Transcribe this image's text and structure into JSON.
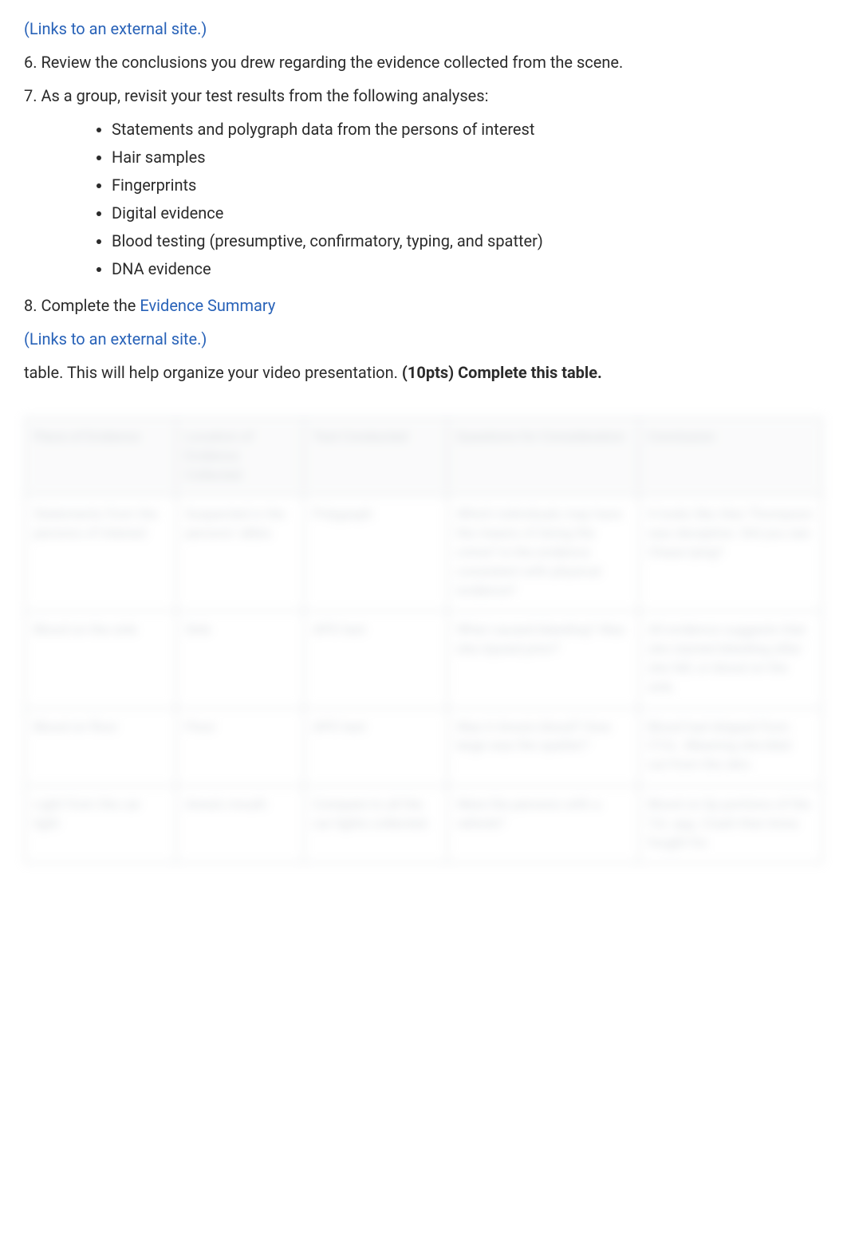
{
  "links": {
    "external1": " (Links to an external site.)",
    "evidenceSummary": "Evidence Summary",
    "external2": " (Links to an external site.)"
  },
  "paras": {
    "p6": "6. Review the conclusions you drew regarding the evidence collected from the scene.",
    "p7": "7. As a group, revisit your test results from the following analyses:",
    "p8_prefix": "8. Complete the ",
    "p9_prefix": " table. This will help organize your video presentation. ",
    "p9_bold": "(10pts) Complete this table."
  },
  "list": {
    "i1": "Statements and polygraph data from the persons of interest",
    "i2": "Hair samples",
    "i3": "Fingerprints",
    "i4": "Digital evidence",
    "i5": "Blood testing (presumptive, confirmatory, typing, and spatter)",
    "i6": "DNA evidence"
  },
  "table": {
    "headers": {
      "h1": "Piece of Evidence",
      "h2": "Location of Evidence Collected",
      "h3": "Test Conducted",
      "h4": "Questions for Consideration",
      "h5": "Conclusion"
    },
    "rows": {
      "r1": {
        "c1": "Statements from the persons of interest",
        "c2": "Suspected in the persons' alibis",
        "c3": "Polygraph",
        "c4": "Which individuals may have the means of doing the crime?\n\nIs the evidence consistent with physical evidence?",
        "c5": "It looks like Alex Thompson was deceptive. Did you see Chase lying?"
      },
      "r2": {
        "c1": "Blood on the sink",
        "c2": "Sink",
        "c3": "APO test",
        "c4": "What caused bleeding?\n\nWas she injured prior?",
        "c5": "All evidence suggests that she started bleeding after she fell, or blood on the sink."
      },
      "r3": {
        "c1": "Blood on floor",
        "c2": "Floor",
        "c3": "APO test",
        "c4": "Was it Anna's blood?\n\nHow large was the spatter?",
        "c5": "Blood had dripped from CTJL. Meaning she bled out from the skin."
      },
      "r4": {
        "c1": "Light from the car light",
        "c2": "Anna's mouth",
        "c3": "Compare to all the car lights collected.",
        "c4": "Were the persons with a vehicle?",
        "c5": "Blood on lip portions of the TJL spg. Crash that Anna fought for."
      }
    }
  }
}
